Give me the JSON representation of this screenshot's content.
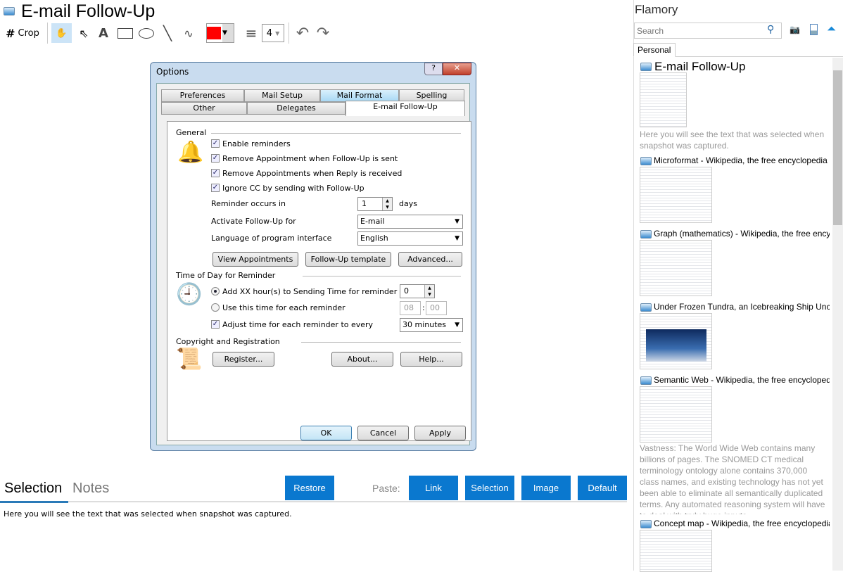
{
  "header": {
    "title": "E-mail Follow-Up"
  },
  "toolbar": {
    "crop_label": "Crop",
    "line_width": "4",
    "color": "#ff0000"
  },
  "dialog": {
    "title": "Options",
    "tabs_row1": [
      "Preferences",
      "Mail Setup",
      "Mail Format",
      "Spelling"
    ],
    "tabs_row2": [
      "Other",
      "Delegates",
      "E-mail Follow-Up"
    ],
    "general": {
      "heading": "General",
      "checks": [
        "Enable reminders",
        "Remove Appointment when Follow-Up is sent",
        "Remove Appointments when Reply is received",
        "Ignore CC by sending with Follow-Up"
      ],
      "reminder_label": "Reminder occurs in",
      "reminder_value": "1",
      "reminder_unit": "days",
      "activate_label": "Activate Follow-Up for",
      "activate_value": "E-mail",
      "language_label": "Language of program interface",
      "language_value": "English",
      "buttons": [
        "View Appointments",
        "Follow-Up template",
        "Advanced..."
      ]
    },
    "time": {
      "heading": "Time of Day for Reminder",
      "radio1": "Add XX hour(s) to Sending Time for reminder",
      "radio1_value": "0",
      "radio2": "Use this time for each reminder",
      "hh": "08",
      "mm": "00",
      "adjust": "Adjust time for each reminder to every",
      "adjust_value": "30 minutes"
    },
    "copyright": {
      "heading": "Copyright and Registration",
      "register": "Register...",
      "about": "About...",
      "help": "Help..."
    },
    "ok": "OK",
    "cancel": "Cancel",
    "apply": "Apply"
  },
  "bottom": {
    "tab_selection": "Selection",
    "tab_notes": "Notes",
    "restore": "Restore",
    "paste_label": "Paste:",
    "paste_buttons": [
      "Link",
      "Selection",
      "Image",
      "Default"
    ],
    "selection_text": "Here you will see the text that was selected when snapshot was captured."
  },
  "sidebar": {
    "title": "Flamory",
    "search_placeholder": "Search",
    "tab": "Personal",
    "items": [
      {
        "title": "E-mail Follow-Up",
        "desc": "Here you will see the text that was selected when snapshot was captured."
      },
      {
        "title": "Microformat - Wikipedia, the free encyclopedia"
      },
      {
        "title": "Graph (mathematics) - Wikipedia, the free encyclopedia"
      },
      {
        "title": "Under Frozen Tundra, an Icebreaking Ship Uncovers"
      },
      {
        "title": "Semantic Web - Wikipedia, the free encyclopedia",
        "desc": "Vastness: The World Wide Web contains many billions of pages. The SNOMED CT medical terminology ontology alone contains 370,000 class names, and existing technology has not yet been able to eliminate all semantically duplicated terms. Any automated reasoning system will have to deal with truly huge inputs."
      },
      {
        "title": "Concept map - Wikipedia, the free encyclopedia"
      }
    ]
  }
}
